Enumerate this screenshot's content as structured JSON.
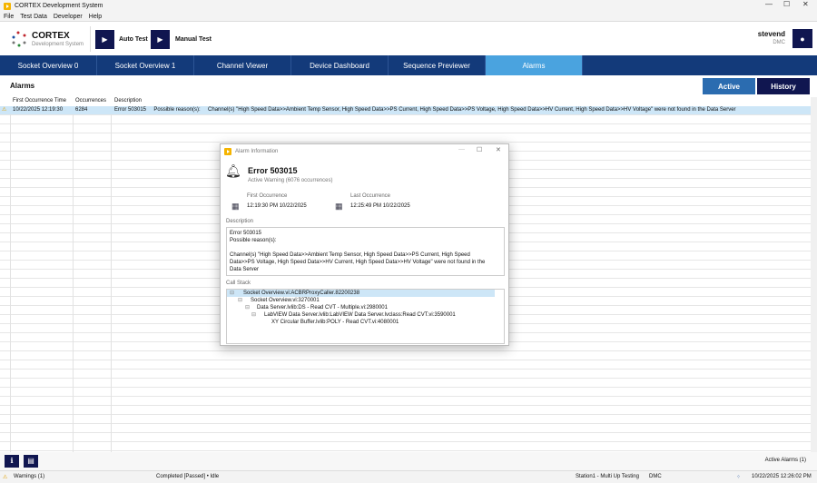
{
  "window": {
    "title": "CORTEX Development System",
    "minimize": "—",
    "maximize": "☐",
    "close": "✕"
  },
  "menu": [
    "File",
    "Test Data",
    "Developer",
    "Help"
  ],
  "logo": {
    "name": "CORTEX",
    "subtitle": "Development System"
  },
  "toolbar": {
    "auto_test": "Auto Test",
    "manual_test": "Manual Test"
  },
  "user": {
    "name": "stevend",
    "org": "DMC"
  },
  "tabs": [
    "Socket Overview 0",
    "Socket Overview 1",
    "Channel Viewer",
    "Device Dashboard",
    "Sequence Previewer",
    "Alarms"
  ],
  "alarms": {
    "title": "Alarms",
    "active_label": "Active",
    "history_label": "History",
    "columns": [
      "First Occurrence Time",
      "Occurrences",
      "Description"
    ],
    "rows": [
      {
        "time": "10/22/2025 12:19:30",
        "occurrences": "6284",
        "description": "Error 503015     Possible reason(s):     Channel(s) \"High Speed Data>>Ambient Temp Sensor, High Speed Data>>PS Current, High Speed Data>>PS Voltage, High Speed Data>>HV Current, High Speed Data>>HV Voltage\" were not found in the Data Server"
      }
    ]
  },
  "dialog": {
    "title": "Alarm Information",
    "error": "Error 503015",
    "status": "Active Warning (6076 occurrences)",
    "first_label": "First Occurrence",
    "first_value": "12:19:30 PM 10/22/2025",
    "last_label": "Last Occurrence",
    "last_value": "12:25:49 PM 10/22/2025",
    "description_label": "Description",
    "description_lines": [
      "Error 503015",
      "Possible reason(s):",
      "",
      "Channel(s) \"High Speed Data>>Ambient Temp Sensor, High Speed Data>>PS Current, High Speed Data>>PS Voltage, High Speed Data>>HV Current, High Speed Data>>HV Voltage\" were not found in the Data Server"
    ],
    "callstack_label": "Call Stack",
    "callstack": [
      "Socket Overview.vi:ACBRProxyCaller.82200238",
      "Socket Overview.vi:3270001",
      "Data Server.lvlib:DS - Read CVT - Multiple.vi:2980001",
      "LabVIEW Data Server.lvlib:LabVIEW Data Server.lvclass:Read CVT.vi:3590001",
      "XY Circular Buffer.lvlib:POLY - Read CVT.vi:4080001"
    ]
  },
  "footer": {
    "active_alarms": "Active Alarms (1)"
  },
  "status": {
    "warnings": "Warnings (1)",
    "state": "Completed [Passed]  •  Idle",
    "station": "Station1 - Multi Up Testing",
    "org": "DMC",
    "datetime": "10/22/2025 12:26:02 PM"
  }
}
